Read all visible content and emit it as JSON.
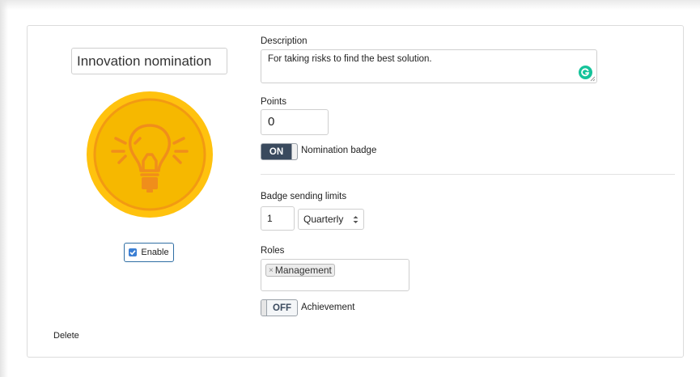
{
  "badge": {
    "name_value": "Innovation nomination",
    "enable_label": "Enable",
    "enabled": true,
    "delete_label": "Delete",
    "icon": "lightbulb-icon",
    "colors": {
      "outer": "#ffc20e",
      "inner": "#f6b800",
      "line": "#f08e1b"
    }
  },
  "description": {
    "label": "Description",
    "value": "For taking risks to find the best solution."
  },
  "points": {
    "label": "Points",
    "value": "0"
  },
  "nomination": {
    "toggle_label": "ON",
    "text": "Nomination badge",
    "on": true
  },
  "limits": {
    "label": "Badge sending limits",
    "count": "1",
    "period": "Quarterly"
  },
  "roles": {
    "label": "Roles",
    "tags": [
      {
        "remove": "×",
        "label": "Management"
      }
    ]
  },
  "achievement": {
    "toggle_label": "OFF",
    "text": "Achievement",
    "on": false
  }
}
